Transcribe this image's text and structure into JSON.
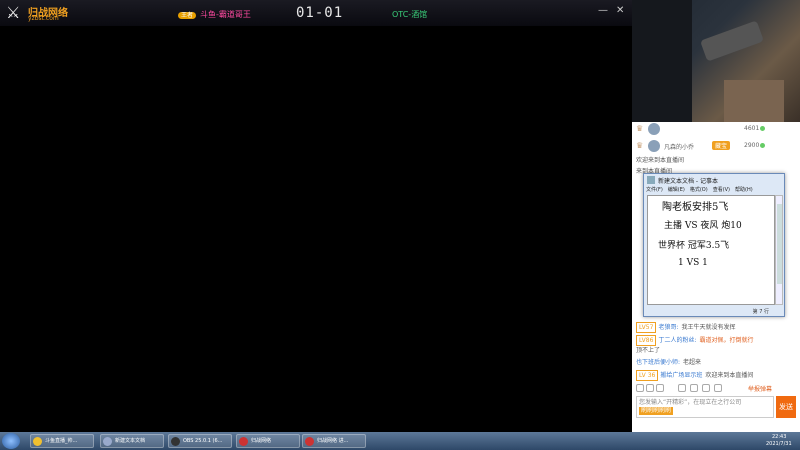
{
  "stream": {
    "logo_text": "归战网络",
    "logo_url": "yzbst.com",
    "team_left_rank": "王者",
    "team_left_name": "斗鱼-霸道哥王",
    "score": "01-01",
    "team_right_name": "OTC-酒馆",
    "min_glyph": "—",
    "close_glyph": "✕"
  },
  "rank_list": [
    {
      "name": "",
      "badge": "",
      "value": "4601"
    },
    {
      "name": "凡森的小乔",
      "badge": "藏宝",
      "value": "2900"
    }
  ],
  "chat": [
    {
      "level": "",
      "nick": "",
      "text": "欢迎来到本直播间"
    },
    {
      "level": "",
      "nick": "",
      "text": "来到本直播间"
    },
    {
      "level": "LV57",
      "nick": "老狼哥:",
      "text": "我王牛天就没有发挥"
    },
    {
      "level": "LV86",
      "nick": "丁二人的粉丝:",
      "text": "霸道对佩，打倒就行"
    },
    {
      "level": "",
      "nick": "",
      "text": "顶不上了"
    },
    {
      "level": "",
      "nick": "也下班后便小师:",
      "text": "老超来"
    },
    {
      "level": "LV 36",
      "nick": "搬给广场显示班",
      "text": "欢迎来到本直播间"
    }
  ],
  "chat_tools": {
    "report": "举报弹幕"
  },
  "chat_input": {
    "placeholder": "您发输入“开精彩”，在现立在之行公司",
    "mini_btn": "刷刷刷刷刷",
    "send": "发送"
  },
  "notepad": {
    "title": "新建文本文档 - 记事本",
    "menu": [
      "文件(F)",
      "编辑(E)",
      "格式(O)",
      "查看(V)",
      "帮助(H)"
    ],
    "lines": [
      "陶老板安排5飞",
      "主播  VS  夜风  炮10",
      "世界杯  冠军3.5飞",
      "1  VS  1"
    ],
    "status": "第 7 行"
  },
  "taskbar": {
    "tasks": [
      "斗鱼直播_帅...",
      "新建文本文档",
      "OBS 25.0.1 (6...",
      "归战网络",
      "归战网络 进..."
    ],
    "time": "22:43",
    "date": "2021/7/31"
  }
}
